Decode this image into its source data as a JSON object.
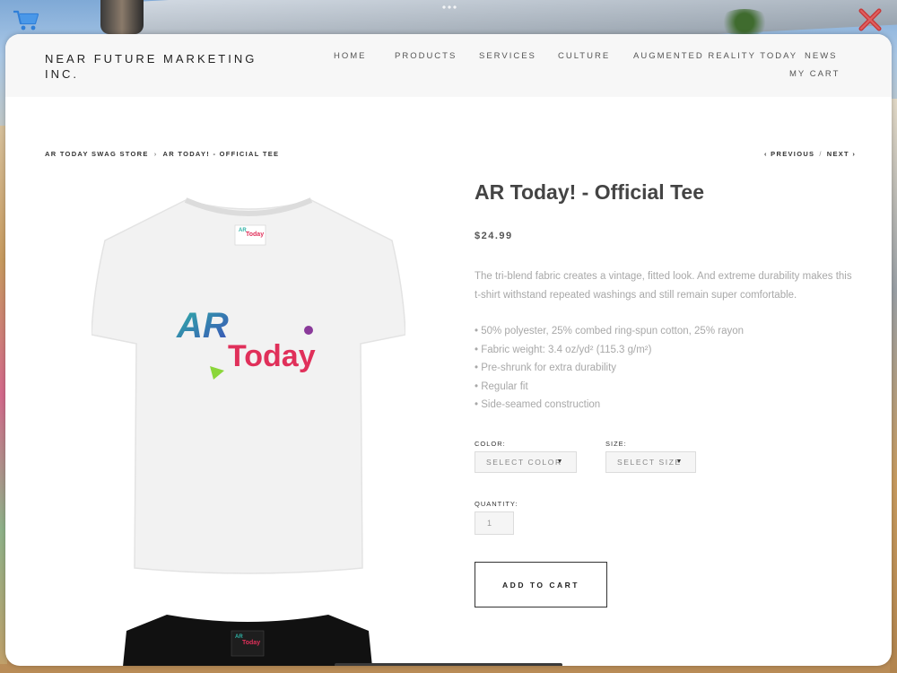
{
  "site": {
    "brand": "NEAR FUTURE MARKETING INC."
  },
  "nav": {
    "home": "HOME",
    "products": "PRODUCTS",
    "services": "SERVICES",
    "culture": "CULTURE",
    "ar_today": "AUGMENTED REALITY TODAY",
    "news": "NEWS",
    "my_cart": "MY CART"
  },
  "breadcrumb": {
    "store": "AR TODAY SWAG STORE",
    "separator": "›",
    "current": "AR TODAY! - OFFICIAL TEE"
  },
  "pager": {
    "previous": "‹ PREVIOUS",
    "separator": "/",
    "next": "NEXT ›"
  },
  "product": {
    "title": "AR Today! - Official Tee",
    "price": "$24.99",
    "description": "The tri-blend fabric creates a vintage, fitted look. And extreme durability makes this t-shirt withstand repeated washings and still remain super comfortable.",
    "bullets": [
      "• 50% polyester, 25% combed ring-spun cotton, 25% rayon",
      "• Fabric weight: 3.4 oz/yd² (115.3 g/m²)",
      "• Pre-shrunk for extra durability",
      "• Regular fit",
      "• Side-seamed construction"
    ],
    "shirt_logo": {
      "ar": "AR",
      "today": "Today"
    }
  },
  "options": {
    "color_label": "COLOR:",
    "color_value": "SELECT COLOR",
    "size_label": "SIZE:",
    "size_value": "SELECT SIZE",
    "caret": "▼"
  },
  "quantity": {
    "label": "QUANTITY:",
    "value": "1"
  },
  "actions": {
    "add_to_cart": "ADD TO CART"
  },
  "icons": {
    "cart": "shopping-cart-icon",
    "close": "close-icon"
  },
  "colors": {
    "close": "#d64545",
    "cart": "#2f7fd8",
    "logo_ar": "#1aa8a0",
    "logo_today": "#e0305a",
    "accent_green": "#8bd63a"
  }
}
